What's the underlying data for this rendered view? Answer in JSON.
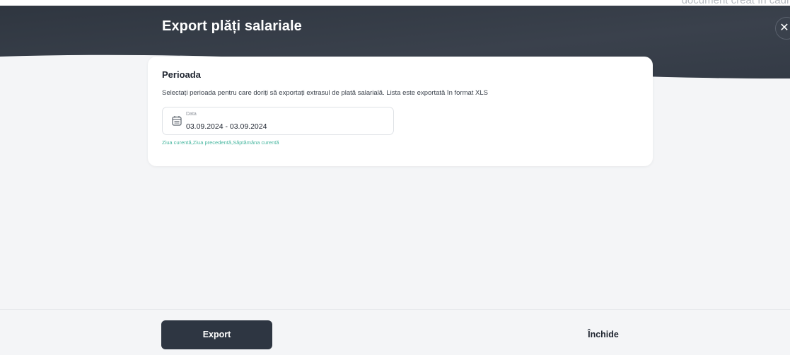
{
  "top_cut_text": "document creat în cadr",
  "header": {
    "title": "Export plăți salariale",
    "close_glyph": "✕"
  },
  "card": {
    "title": "Perioada",
    "description": "Selectați perioada pentru care doriți să exportați extrasul de plată salarială. Lista este exportată în format XLS",
    "date_field": {
      "label": "Data",
      "value": "03.09.2024 - 03.09.2024",
      "icon": "calendar-icon"
    },
    "quick_links": [
      "Ziua curentă",
      "Ziua precedentă",
      "Săptămâna curentă"
    ]
  },
  "footer": {
    "export_label": "Export",
    "close_label": "Închide"
  },
  "colors": {
    "header_dark": "#343b46",
    "primary_button": "#2e3642",
    "link_accent": "#49b7a0",
    "background": "#f4f5f7"
  }
}
